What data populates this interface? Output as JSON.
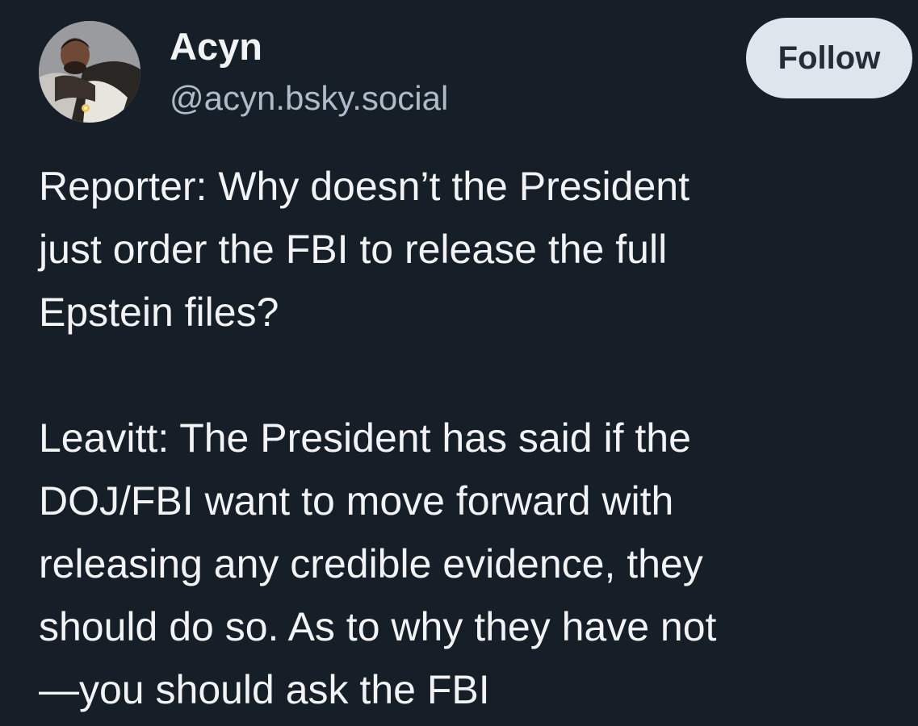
{
  "author": {
    "display_name": "Acyn",
    "handle": "@acyn.bsky.social",
    "avatar_icon": "user-avatar-photo"
  },
  "actions": {
    "follow_label": "Follow"
  },
  "post": {
    "paragraph_1": [
      "Reporter: Why doesn’t the President",
      "just order the FBI to release the full",
      "Epstein files?"
    ],
    "paragraph_2": [
      "Leavitt: The President has said if the",
      "DOJ/FBI want to move forward with",
      "releasing any credible evidence, they",
      "should do so. As to why they have not",
      "—you should ask the FBI"
    ]
  },
  "colors": {
    "background": "#161e27",
    "text": "#f1f3f5",
    "handle": "#aebbc9",
    "follow_button_bg": "#dfe5ec",
    "follow_button_text": "#242c35"
  }
}
